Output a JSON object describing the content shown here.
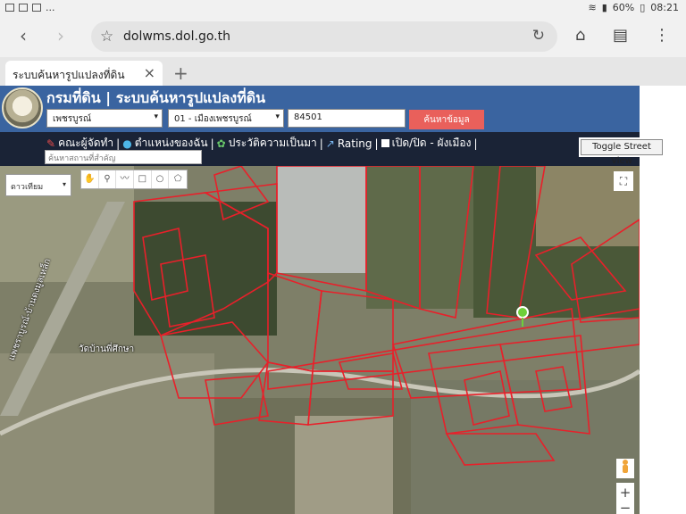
{
  "status_bar": {
    "notifications": "...",
    "battery": "60%",
    "time": "08:21"
  },
  "browser": {
    "url": "dolwms.dol.go.th",
    "tab_title": "ระบบค้นหารูปแปลงที่ดิน",
    "back_icon": "back-arrow-icon",
    "forward_icon": "forward-arrow-icon"
  },
  "site": {
    "title": "กรมที่ดิน | ระบบค้นหารูปแปลงที่ดิน",
    "province_select": "เพชรบูรณ์",
    "district_select": "01 - เมืองเพชรบูรณ์",
    "parcel_input": "84501",
    "search_button": "ค้นหาข้อมูล",
    "menu": {
      "team": "คณะผู้จัดทำ",
      "sep1": "|",
      "my_location": "ตำแหน่งของฉัน",
      "sep2": "|",
      "history": "ประวัติความเป็นมา",
      "sep3": "|",
      "rating": "Rating",
      "sep4": "|",
      "toggle_plan": "เปิด/ปิด - ผังเมือง",
      "sep5": "|"
    },
    "place_search_placeholder": "ค้นหาสถานที่สำคัญ",
    "street_view_button": "Toggle Street View"
  },
  "map": {
    "map_type_select": "ดาวเทียม",
    "labels": {
      "temple": "วัดบ้านพี่ศึกษา",
      "road": "แพชราบูรณ์-บ้านดงมูลเหล็ก"
    },
    "zoom_in": "+",
    "zoom_out": "−"
  },
  "colors": {
    "header_bg": "#3a64a0",
    "menubar_bg": "#1a2336",
    "search_button": "#e9605b",
    "parcel_lines": "#e8202a"
  }
}
